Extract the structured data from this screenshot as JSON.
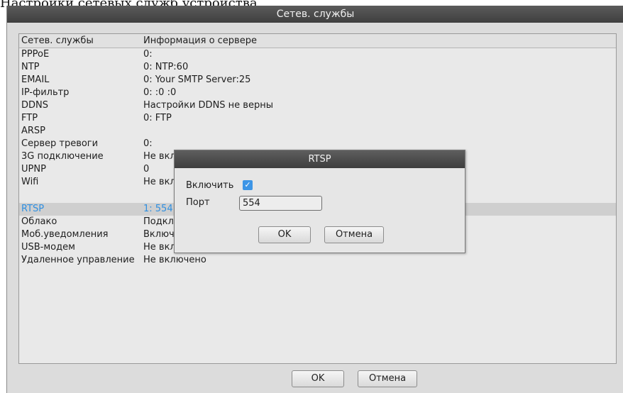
{
  "cropped_top_text": "Настройки сетевых служб устройства",
  "window": {
    "title": "Сетев. службы"
  },
  "table": {
    "headers": {
      "service": "Сетев. службы",
      "info": "Информация о сервере"
    },
    "rows": [
      {
        "service": "PPPoE",
        "info": "0:"
      },
      {
        "service": "NTP",
        "info": "0: NTP:60"
      },
      {
        "service": "EMAIL",
        "info": "0: Your SMTP Server:25"
      },
      {
        "service": "IP-фильтр",
        "info": "0: :0 :0"
      },
      {
        "service": "DDNS",
        "info": "Настройки DDNS не верны"
      },
      {
        "service": "FTP",
        "info": "0: FTP"
      },
      {
        "service": "ARSP",
        "info": ""
      },
      {
        "service": "Сервер тревоги",
        "info": "0:"
      },
      {
        "service": "3G подключение",
        "info": "Не включено"
      },
      {
        "service": "UPNP",
        "info": "0"
      },
      {
        "service": "Wifi",
        "info": "Не включено"
      },
      {
        "service": "RTSP",
        "info": "1: 554"
      },
      {
        "service": "Облако",
        "info": "Подключено"
      },
      {
        "service": "Моб.уведомления",
        "info": "Включено"
      },
      {
        "service": "USB-модем",
        "info": "Не включено"
      },
      {
        "service": "Удаленное управление",
        "info": "Не включено"
      }
    ],
    "selected_index": 11
  },
  "dialog": {
    "title": "RTSP",
    "enable_label": "Включить",
    "enable_checked": true,
    "check_glyph": "✓",
    "port_label": "Порт",
    "port_value": "554",
    "ok_label": "OK",
    "cancel_label": "Отмена"
  },
  "footer": {
    "ok_label": "OK",
    "cancel_label": "Отмена"
  },
  "colors": {
    "selected_text": "#2f8fe0",
    "title_bar": "#4a4a4a",
    "checkbox": "#3d95e6"
  }
}
